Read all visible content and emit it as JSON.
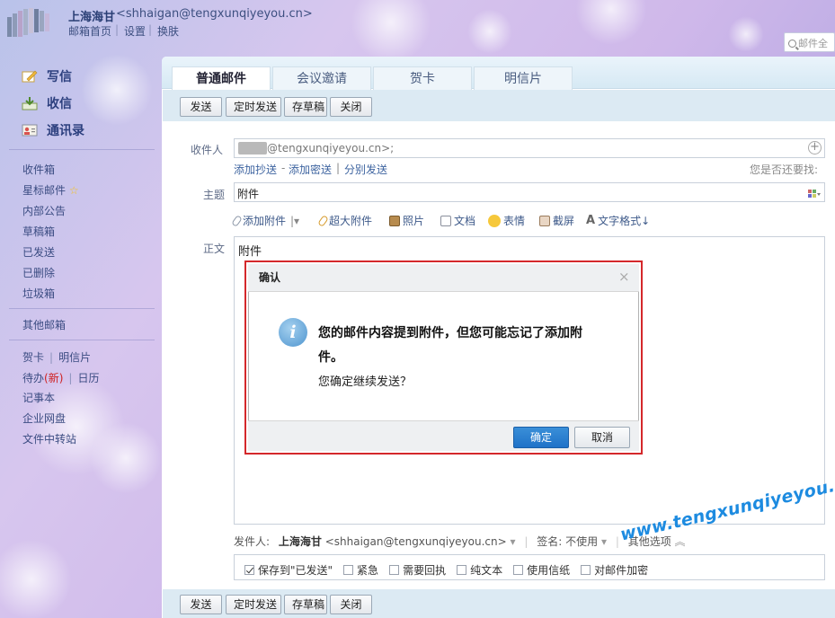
{
  "header": {
    "user_name": "上海海甘",
    "user_email": "<shhaigan@tengxunqiyeyou.cn>",
    "links": [
      "邮箱首页",
      "设置",
      "换肤"
    ],
    "search_placeholder": "邮件全"
  },
  "sidebar": {
    "main": [
      "写信",
      "收信",
      "通讯录"
    ],
    "folders": [
      "收件箱",
      "星标邮件",
      "内部公告",
      "草稿箱",
      "已发送",
      "已删除",
      "垃圾箱"
    ],
    "other_mail": "其他邮箱",
    "apps": {
      "greeting_card": "贺卡",
      "postcard": "明信片",
      "todo": "待办",
      "todo_badge": "(新)",
      "calendar": "日历",
      "notes": "记事本",
      "disk": "企业网盘",
      "transfer": "文件中转站"
    }
  },
  "tabs": [
    "普通邮件",
    "会议邀请",
    "贺卡",
    "明信片"
  ],
  "toolbar": [
    "发送",
    "定时发送",
    "存草稿",
    "关闭"
  ],
  "compose": {
    "to_label": "收件人",
    "to_value": "@tengxunqiyeyou.cn>;",
    "add_cc": "添加抄送",
    "add_bcc": "添加密送",
    "separate_send": "分别发送",
    "hint": "您是否还要找:",
    "subject_label": "主题",
    "subject_value": "附件",
    "tools": [
      "添加附件",
      "超大附件",
      "照片",
      "文档",
      "表情",
      "截屏",
      "文字格式↓"
    ],
    "body_label": "正文",
    "body_text": "附件",
    "sender_label": "发件人:",
    "sender_name": "上海海甘",
    "sender_email": "<shhaigan@tengxunqiyeyou.cn>",
    "signature_label": "签名:",
    "signature_value": "不使用",
    "more_options": "其他选项",
    "options": [
      {
        "label": "保存到\"已发送\"",
        "checked": true
      },
      {
        "label": "紧急",
        "checked": false
      },
      {
        "label": "需要回执",
        "checked": false
      },
      {
        "label": "纯文本",
        "checked": false
      },
      {
        "label": "使用信纸",
        "checked": false
      },
      {
        "label": "对邮件加密",
        "checked": false
      }
    ]
  },
  "dialog": {
    "title": "确认",
    "message_line1": "您的邮件内容提到附件，但您可能忘记了添加附",
    "message_line2": "件。",
    "question": "您确定继续发送？",
    "ok": "确定",
    "cancel": "取消"
  },
  "watermark": "www.tengxunqiyeyou.com",
  "colors": {
    "accent": "#1f72c8",
    "highlight_border": "#d4282b",
    "watermark": "#1d8be0"
  }
}
